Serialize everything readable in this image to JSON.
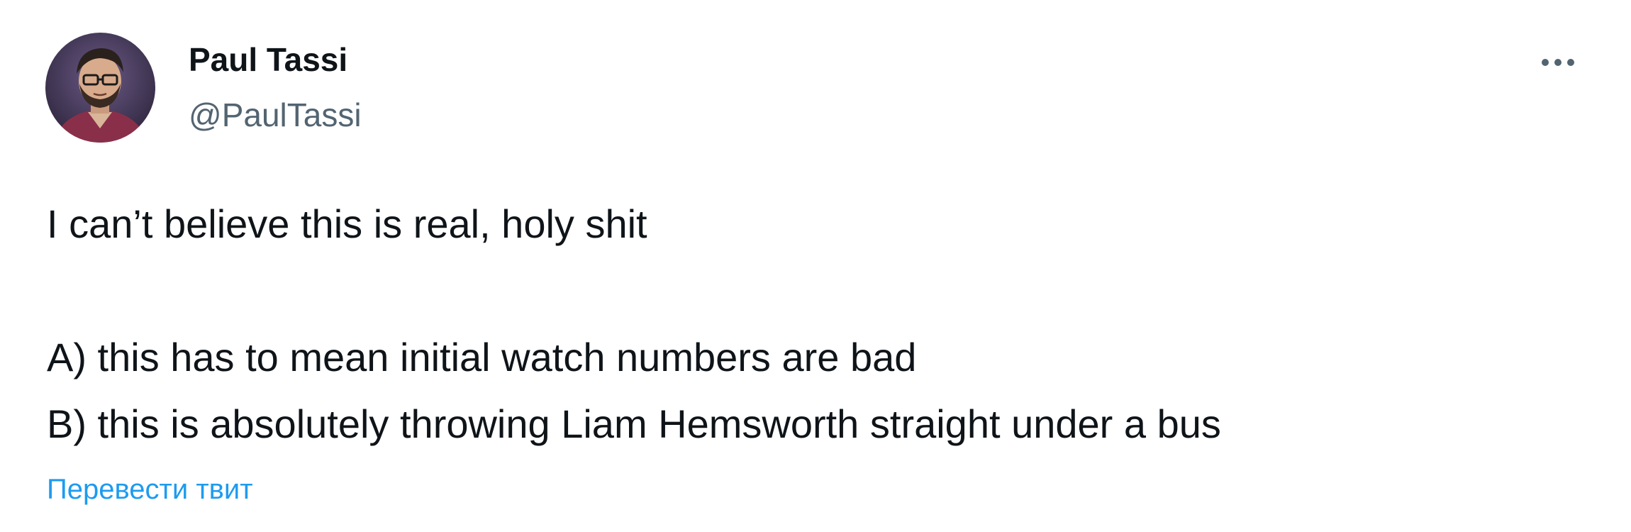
{
  "author": {
    "display_name": "Paul Tassi",
    "handle": "@PaulTassi",
    "avatar_icon": "user-avatar"
  },
  "more_icon": "more-horizontal-icon",
  "tweet": {
    "lines": [
      "I can’t believe this is real, holy shit",
      "A) this has to mean initial watch numbers are bad",
      "B) this is absolutely throwing Liam Hemsworth straight under a bus"
    ]
  },
  "translate_label": "Перевести твит",
  "colors": {
    "text_primary": "#0f1419",
    "text_secondary": "#536471",
    "link": "#1d9bf0"
  }
}
